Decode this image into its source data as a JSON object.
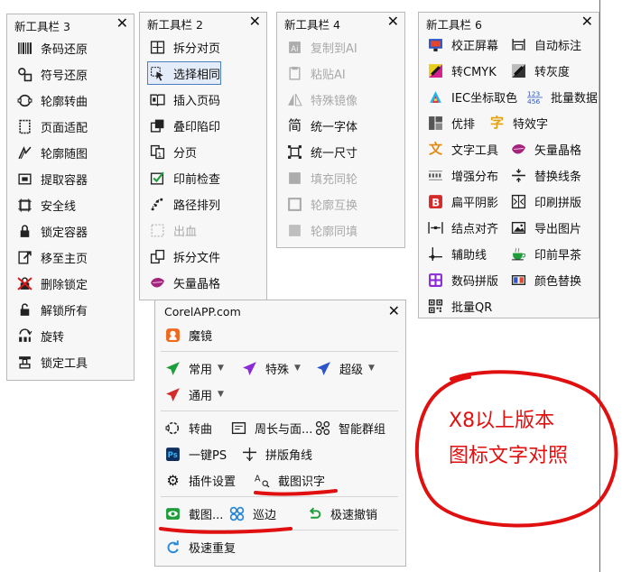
{
  "panel3": {
    "title": "新工具栏 3",
    "items": [
      "条码还原",
      "符号还原",
      "轮廓转曲",
      "页面适配",
      "轮廓随图",
      "提取容器",
      "安全线",
      "锁定容器",
      "移至主页",
      "删除锁定",
      "解锁所有",
      "旋转",
      "锁定工具"
    ]
  },
  "panel2": {
    "title": "新工具栏 2",
    "items": [
      "拆分对页",
      "选择相同",
      "插入页码",
      "叠印陷印",
      "分页",
      "印前检查",
      "路径排列",
      "出血",
      "拆分文件",
      "矢量晶格"
    ]
  },
  "panel4": {
    "title": "新工具栏 4",
    "items": [
      "复制到AI",
      "粘贴AI",
      "特殊镜像",
      "统一字体",
      "统一尺寸",
      "填充同轮",
      "轮廓互换",
      "轮廓同填"
    ]
  },
  "panel6": {
    "title": "新工具栏 6",
    "items": [
      "校正屏幕",
      "自动标注",
      "转CMYK",
      "转灰度",
      "IEC坐标取色",
      "批量数据",
      "优排",
      "特效字",
      "文字工具",
      "矢量晶格",
      "增强分布",
      "替换线条",
      "扁平阴影",
      "印刷拼版",
      "结点对齐",
      "导出图片",
      "辅助线",
      "印前早茶",
      "数码拼版",
      "颜色替换",
      "批量QR"
    ]
  },
  "corel": {
    "title": "CorelAPP.com",
    "items": [
      "魔镜",
      "常用",
      "特殊",
      "超级",
      "通用",
      "转曲",
      "周长与面...",
      "智能群组",
      "一键PS",
      "拼版角线",
      "插件设置",
      "截图识字",
      "截图...",
      "巡边",
      "极速撤销",
      "极速重复"
    ]
  },
  "annotation": {
    "line1": "X8以上版本",
    "line2": "图标文字对照"
  },
  "colors": {
    "annotation_red": "#e01010",
    "purple": "#8a2bd6",
    "blue": "#2b55c8",
    "green": "#1f9d3a"
  },
  "close_glyph": "✕"
}
